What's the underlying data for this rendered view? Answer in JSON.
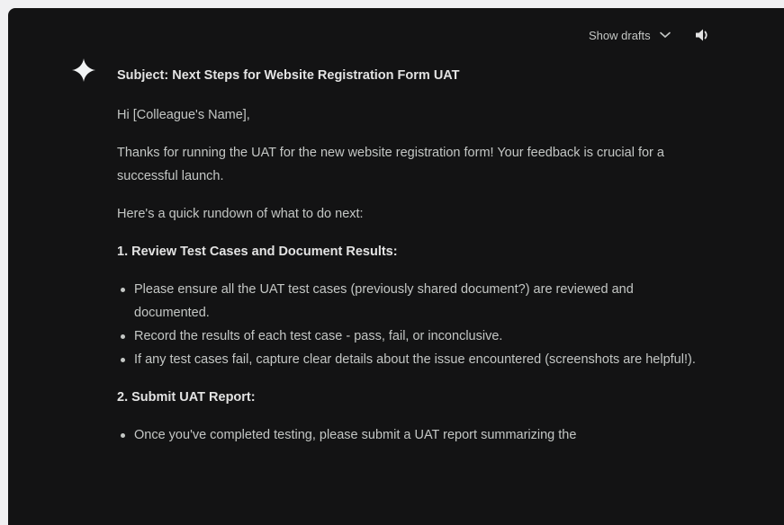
{
  "toolbar": {
    "show_drafts_label": "Show drafts",
    "speaker_icon": "volume-icon",
    "dropdown_icon": "chevron-down-icon"
  },
  "response": {
    "subject": "Subject: Next Steps for Website Registration Form UAT",
    "greeting": "Hi [Colleague's Name],",
    "intro": "Thanks for running the UAT for the new website registration form! Your feedback is crucial for a successful launch.",
    "rundown": "Here's a quick rundown of what to do next:",
    "sections": [
      {
        "heading": "1. Review Test Cases and Document Results:",
        "bullets": [
          "Please ensure all the UAT test cases (previously shared document?) are reviewed and documented.",
          "Record the results of each test case - pass, fail, or inconclusive.",
          "If any test cases fail, capture clear details about the issue encountered (screenshots are helpful!)."
        ]
      },
      {
        "heading": "2. Submit UAT Report:",
        "bullets": [
          "Once you've completed testing, please submit a UAT report summarizing the"
        ]
      }
    ]
  },
  "colors": {
    "background": "#131314",
    "text": "#c4c7c5",
    "heading": "#e3e3e3",
    "outer": "#f0f0f2"
  }
}
